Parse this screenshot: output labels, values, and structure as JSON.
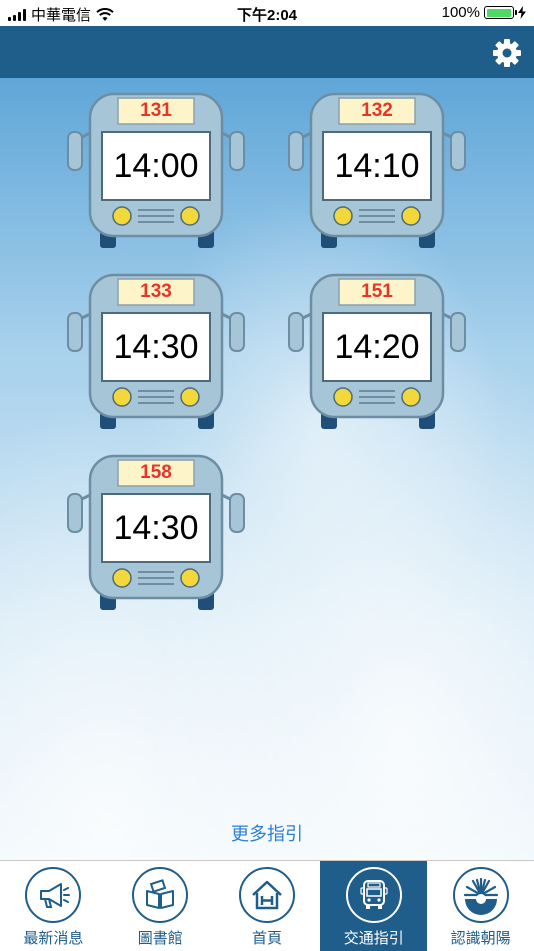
{
  "status_bar": {
    "carrier": "中華電信",
    "time": "下午2:04",
    "battery": "100%"
  },
  "buses": [
    {
      "route": "131",
      "time": "14:00"
    },
    {
      "route": "132",
      "time": "14:10"
    },
    {
      "route": "133",
      "time": "14:30"
    },
    {
      "route": "151",
      "time": "14:20"
    },
    {
      "route": "158",
      "time": "14:30"
    }
  ],
  "more_link": "更多指引",
  "tabs": [
    {
      "label": "最新消息",
      "icon": "megaphone-icon"
    },
    {
      "label": "圖書館",
      "icon": "books-icon"
    },
    {
      "label": "首頁",
      "icon": "home-icon"
    },
    {
      "label": "交通指引",
      "icon": "bus-icon",
      "active": true
    },
    {
      "label": "認識朝陽",
      "icon": "sun-gear-icon"
    }
  ],
  "colors": {
    "header": "#1f5d8b",
    "bus_body": "#a6c6d8",
    "route_text": "#e5362b",
    "link": "#2d7fd6"
  }
}
